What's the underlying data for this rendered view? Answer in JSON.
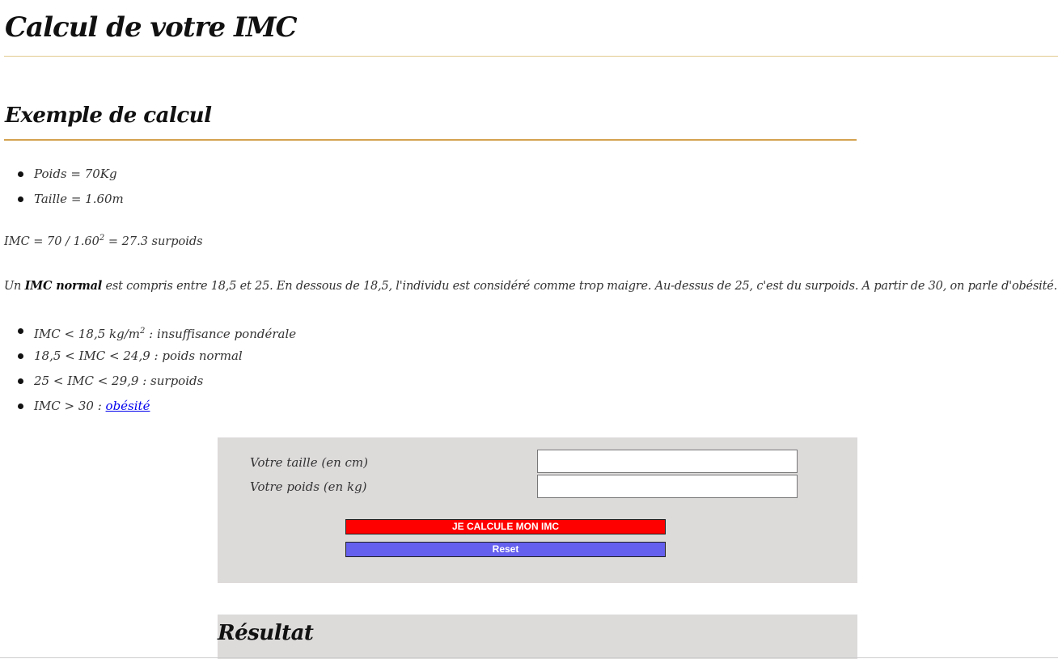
{
  "header": {
    "title": "Calcul de votre IMC"
  },
  "example": {
    "title": "Exemple de calcul",
    "items": [
      "Poids = 70Kg",
      "Taille = 1.60m"
    ],
    "formula_before": "IMC = 70 / 1.60",
    "formula_exp": "2",
    "formula_after": " = 27.3 surpoids"
  },
  "info": {
    "prefix": "Un ",
    "bold": "IMC normal",
    "text": " est compris entre 18,5 et 25. En dessous de 18,5, l'individu est considéré comme trop maigre. Au-dessus de 25, c'est du surpoids. A partir de 30, on parle d'obésité."
  },
  "ranges": {
    "item1_before": "IMC < 18,5 kg/m",
    "item1_exp": "2",
    "item1_after": " : insuffisance pondérale",
    "item2": "18,5 < IMC < 24,9 : poids normal",
    "item3": "25 < IMC < 29,9 : surpoids",
    "item4_before": "IMC > 30 : ",
    "item4_link": "obésité"
  },
  "form": {
    "height_label": "Votre taille (en cm)",
    "height_value": "",
    "weight_label": "Votre poids (en kg)",
    "weight_value": "",
    "calc_button": "JE CALCULE MON IMC",
    "reset_button": "Reset"
  },
  "result": {
    "title": "Résultat"
  },
  "colors": {
    "calc_button": "#ff0000",
    "reset_button": "#6660ee",
    "panel_background": "#dddada",
    "section_rule": "#d4a351",
    "link": "#0000ee"
  }
}
